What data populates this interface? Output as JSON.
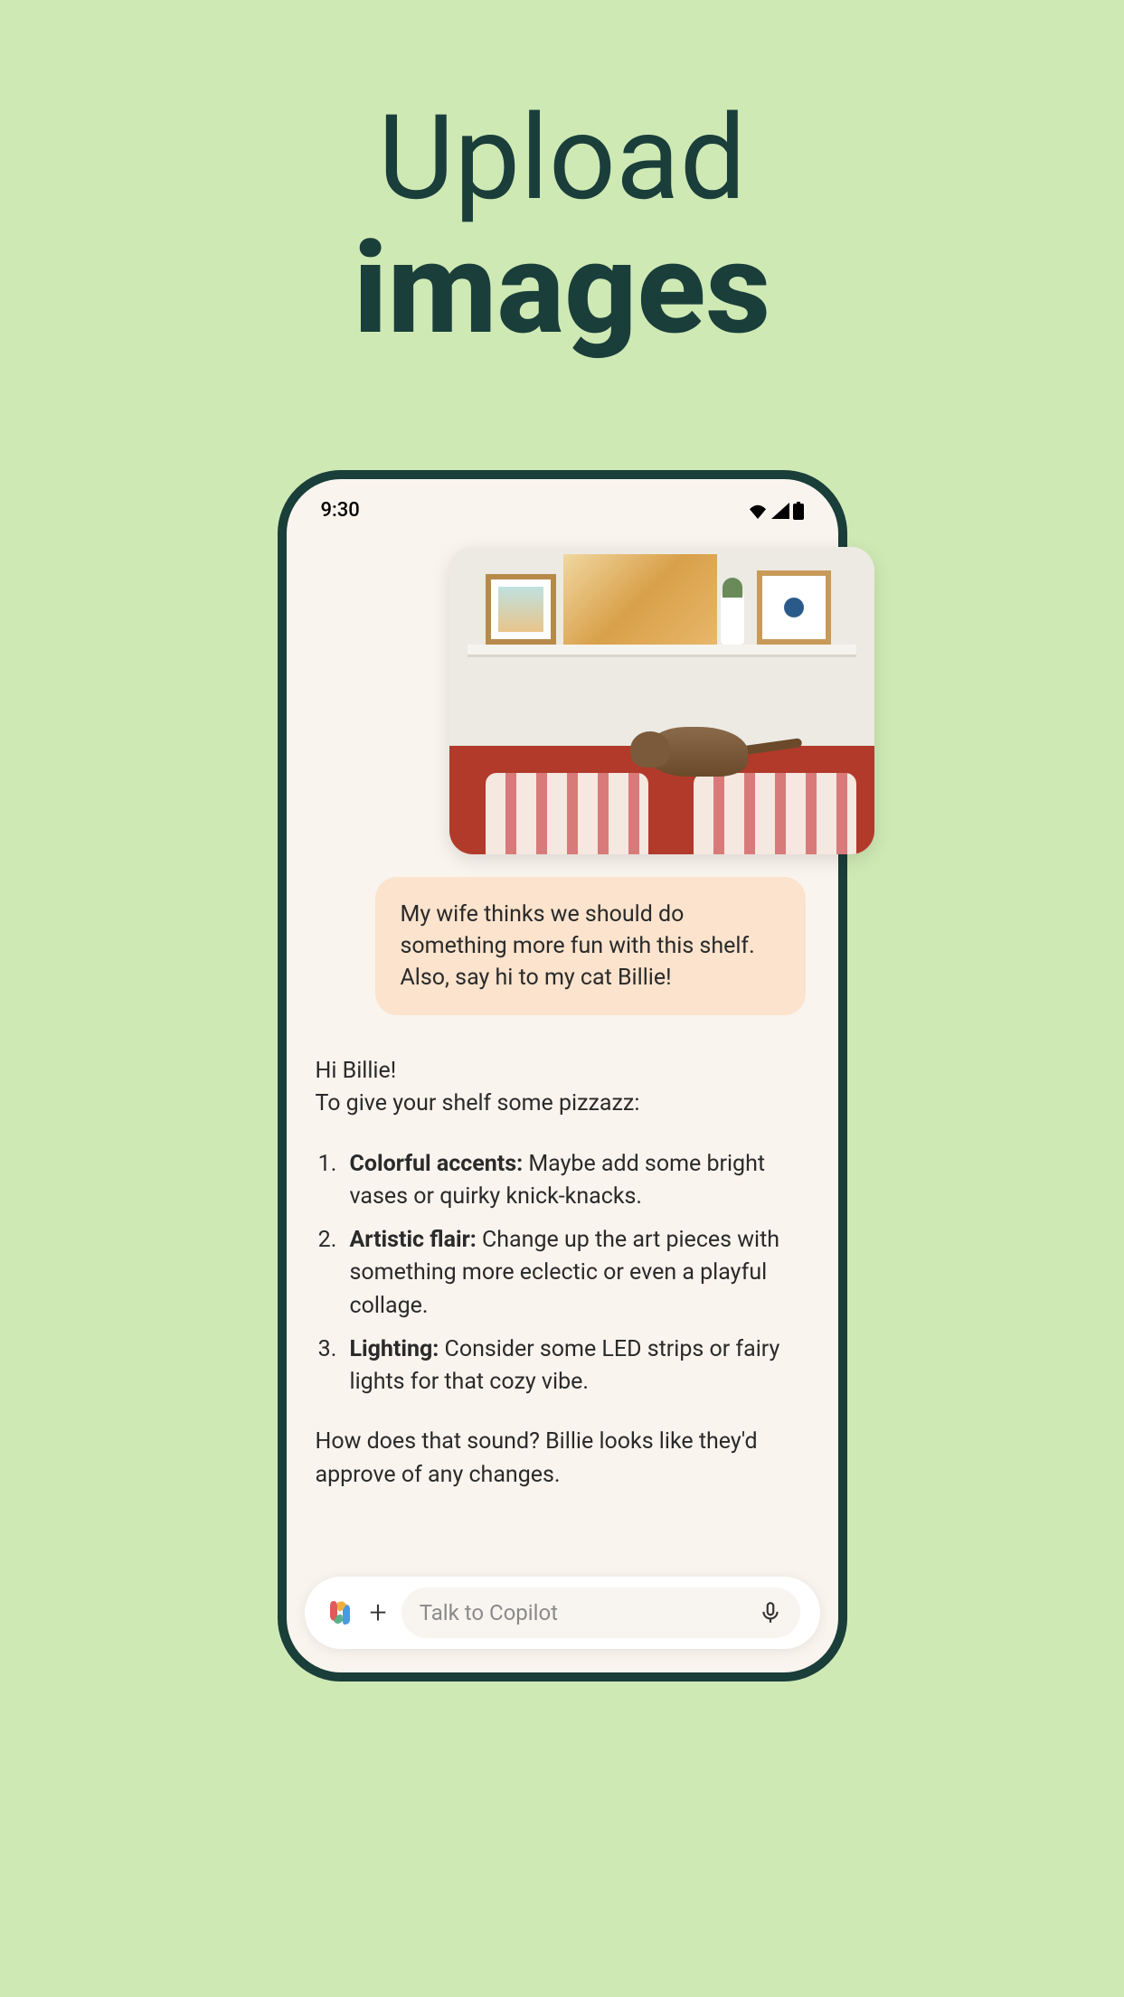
{
  "headline": {
    "line1": "Upload",
    "line2": "images"
  },
  "status_bar": {
    "time": "9:30"
  },
  "user_message": "My wife thinks we should do something more fun with this shelf. Also, say hi to my cat Billie!",
  "ai": {
    "greeting": "Hi Billie!",
    "intro": "To give your shelf some pizzazz:",
    "items": [
      {
        "num": "1.",
        "title": "Colorful accents:",
        "body": " Maybe add some bright vases or quirky knick-knacks."
      },
      {
        "num": "2.",
        "title": "Artistic flair:",
        "body": " Change up the art pieces with something more eclectic or even a playful collage."
      },
      {
        "num": "3.",
        "title": "Lighting:",
        "body": " Consider some LED strips or fairy lights for that cozy vibe."
      }
    ],
    "followup": "How does that sound? Billie looks like they'd approve of any changes."
  },
  "input": {
    "placeholder": "Talk to Copilot"
  }
}
